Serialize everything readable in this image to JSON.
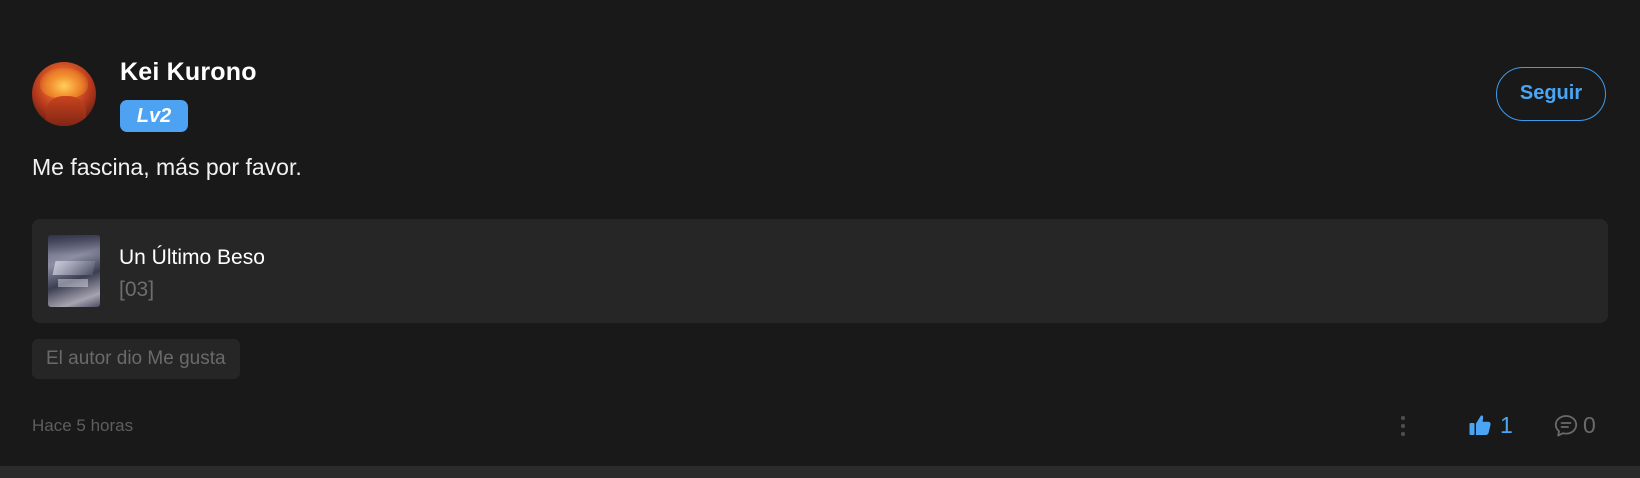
{
  "comment": {
    "author": {
      "name": "Kei Kurono",
      "level": "Lv2",
      "avatar_icon": "avatar-image"
    },
    "follow_label": "Seguir",
    "text": "Me fascina, más por favor.",
    "work": {
      "title": "Un Último Beso",
      "chapter": "[03]"
    },
    "author_like_tag": "El autor dio Me gusta",
    "timestamp": "Hace 5 horas",
    "likes": "1",
    "replies": "0",
    "icons": {
      "more": "more-vertical-icon",
      "like": "thumbs-up-icon",
      "reply": "comment-bubble-icon"
    }
  },
  "colors": {
    "background": "#191919",
    "card": "#262626",
    "accent": "#4aa6f5",
    "level_badge": "#4da3f2",
    "muted_text": "#6a6a6a"
  }
}
